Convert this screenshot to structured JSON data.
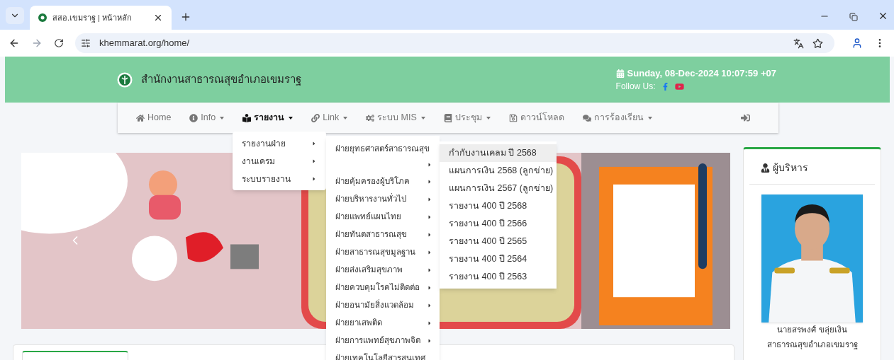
{
  "browser": {
    "tab_title": "สสอ.เขมราฐ | หน้าหลัก",
    "url": "khemmarat.org/home/"
  },
  "header": {
    "site_title": "สำนักงานสาธารณสุขอำเภอเขมราฐ",
    "datetime": "Sunday, 08-Dec-2024 10:07:59 +07",
    "follow_label": "Follow Us:"
  },
  "nav": [
    {
      "kind": "home",
      "label": "Home",
      "dropdown": false,
      "selected": false
    },
    {
      "kind": "info",
      "label": "Info",
      "dropdown": true,
      "selected": false
    },
    {
      "kind": "report",
      "label": "รายงาน",
      "dropdown": true,
      "selected": true
    },
    {
      "kind": "link",
      "label": "Link",
      "dropdown": true,
      "selected": false
    },
    {
      "kind": "mis",
      "label": "ระบบ MIS",
      "dropdown": true,
      "selected": false
    },
    {
      "kind": "meeting",
      "label": "ประชุม",
      "dropdown": true,
      "selected": false
    },
    {
      "kind": "download",
      "label": "ดาวน์โหลด",
      "dropdown": false,
      "selected": false
    },
    {
      "kind": "complaint",
      "label": "การร้องเรียน",
      "dropdown": true,
      "selected": false
    }
  ],
  "menu_level1": [
    {
      "label": "รายงานฝ่าย"
    },
    {
      "label": "งานเครม"
    },
    {
      "label": "ระบบรายงาน"
    }
  ],
  "menu_level2": [
    {
      "label": "ฝ่ายยุทธศาสตร์สาธารณสุข",
      "has_submenu": true
    },
    {
      "label": "ฝ่ายคุ้มครองผู้บริโภค",
      "has_submenu": true
    },
    {
      "label": "ฝ่ายบริหารงานทั่วไป",
      "has_submenu": true
    },
    {
      "label": "ฝ่ายแพทย์แผนไทย",
      "has_submenu": true
    },
    {
      "label": "ฝ่ายทันตสาธารณสุข",
      "has_submenu": true
    },
    {
      "label": "ฝ่ายสาธารณสุขมูลฐาน",
      "has_submenu": true
    },
    {
      "label": "ฝ่ายส่งเสริมสุขภาพ",
      "has_submenu": true
    },
    {
      "label": "ฝ่ายควบคุมโรคไม่ติดต่อ",
      "has_submenu": true
    },
    {
      "label": "ฝ่ายอนามัยสิ่งแวดล้อม",
      "has_submenu": true
    },
    {
      "label": "ฝ่ายยาเสพติด",
      "has_submenu": true
    },
    {
      "label": "ฝ่ายการแพทย์สุขภาพจิต",
      "has_submenu": true
    },
    {
      "label": "ฝ่ายเทคโนโลยีสารสนเทศ",
      "has_submenu": false
    }
  ],
  "menu_level3": [
    {
      "label": "กำกับงานเคลม ปี 2568",
      "hovered": true
    },
    {
      "label": "แผนการเงิน 2568 (ลูกข่าย)",
      "hovered": false
    },
    {
      "label": "แผนการเงิน 2567 (ลูกข่าย)",
      "hovered": false
    },
    {
      "label": "รายงาน 400 ปี 2568",
      "hovered": false
    },
    {
      "label": "รายงาน 400 ปี 2566",
      "hovered": false
    },
    {
      "label": "รายงาน 400 ปี 2565",
      "hovered": false
    },
    {
      "label": "รายงาน 400 ปี 2564",
      "hovered": false
    },
    {
      "label": "รายงาน 400 ปี 2563",
      "hovered": false
    }
  ],
  "executive": {
    "title": "ผู้บริหาร",
    "name": "นายสรพงศ์ ขลุ่ยเงิน",
    "position": "สาธารณสุขอำเภอเขมราฐ"
  }
}
